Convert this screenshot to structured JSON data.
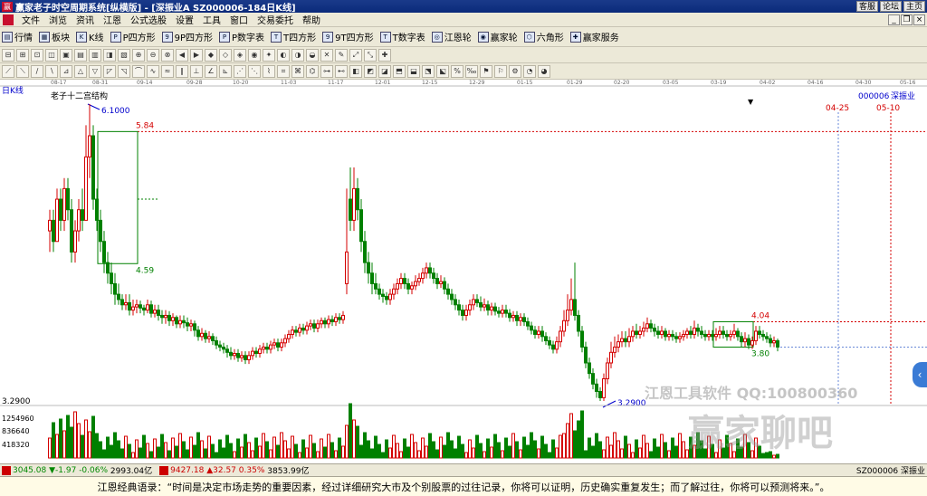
{
  "titlebar": {
    "title": "赢家老子时空周期系统[纵横版] - [深振业A  SZ000006-184日K线]",
    "links": [
      "客服",
      "论坛",
      "主页"
    ]
  },
  "menubar": {
    "items": [
      "文件",
      "浏览",
      "资讯",
      "江恩",
      "公式选股",
      "设置",
      "工具",
      "窗口",
      "交易委托",
      "帮助"
    ]
  },
  "toolbar1": {
    "items": [
      {
        "label": "行情",
        "icon": "quote-icon"
      },
      {
        "label": "板块",
        "icon": "sector-icon"
      },
      {
        "label": "K线",
        "icon": "kline-icon"
      },
      {
        "label": "P四方形",
        "icon": "square-icon"
      },
      {
        "label": "9P四方形",
        "icon": "square-icon"
      },
      {
        "label": "P数字表",
        "icon": "table-icon"
      },
      {
        "label": "T四方形",
        "icon": "square-icon"
      },
      {
        "label": "9T四方形",
        "icon": "square-icon"
      },
      {
        "label": "T数字表",
        "icon": "table-icon"
      },
      {
        "label": "江恩轮",
        "icon": "wheel-icon"
      },
      {
        "label": "赢家轮",
        "icon": "wheel-icon"
      },
      {
        "label": "六角形",
        "icon": "hexagon-icon"
      },
      {
        "label": "赢家服务",
        "icon": "service-icon"
      }
    ]
  },
  "chart": {
    "period_label": "日K线",
    "indicator_label": "老子十二宫结构",
    "stock_code": "000006",
    "stock_name": "深振业",
    "date_ticks": [
      "08-17",
      "08-31",
      "09-14",
      "09-28",
      "10-20",
      "11-03",
      "11-17",
      "12-01",
      "12-15",
      "12-29",
      "01-15",
      "01-29",
      "02-20",
      "03-05",
      "03-19",
      "04-02",
      "04-16",
      "04-30",
      "05-16"
    ],
    "future_date_labels": [
      "04-25",
      "05-10"
    ],
    "annotations": {
      "high": "6.1000",
      "low": "3.2900",
      "box1_top": "5.84",
      "box1_bottom": "4.59",
      "box2_top": "4.04",
      "box2_bottom": "3.80"
    },
    "left_price_label": "3.2900",
    "volume_ticks": [
      "1254960",
      "836640",
      "418320"
    ],
    "colors": {
      "up": "#d40000",
      "down": "#008000",
      "box": "#008000",
      "dash_red": "#d40000",
      "dash_blue": "#4a6ad0"
    }
  },
  "statusbar": {
    "sh_index": "3045.08",
    "sh_change": "-1.97",
    "sh_pct": "-0.06%",
    "sh_amount": "2993.04亿",
    "sz_index": "9427.18",
    "sz_change": "32.57",
    "sz_pct": "0.35%",
    "sz_amount": "3853.99亿",
    "stock": "SZ000006 深振业"
  },
  "quote": "江恩经典语录：“时间是决定市场走势的重要因素，经过详细研究大市及个别股票的过往记录，你将可以证明，历史确实重复发生；而了解过往，你将可以预测将来。”。",
  "watermark": {
    "line1": "江恩工具软件   QQ:100800360",
    "line2": "赢家聊吧"
  }
}
